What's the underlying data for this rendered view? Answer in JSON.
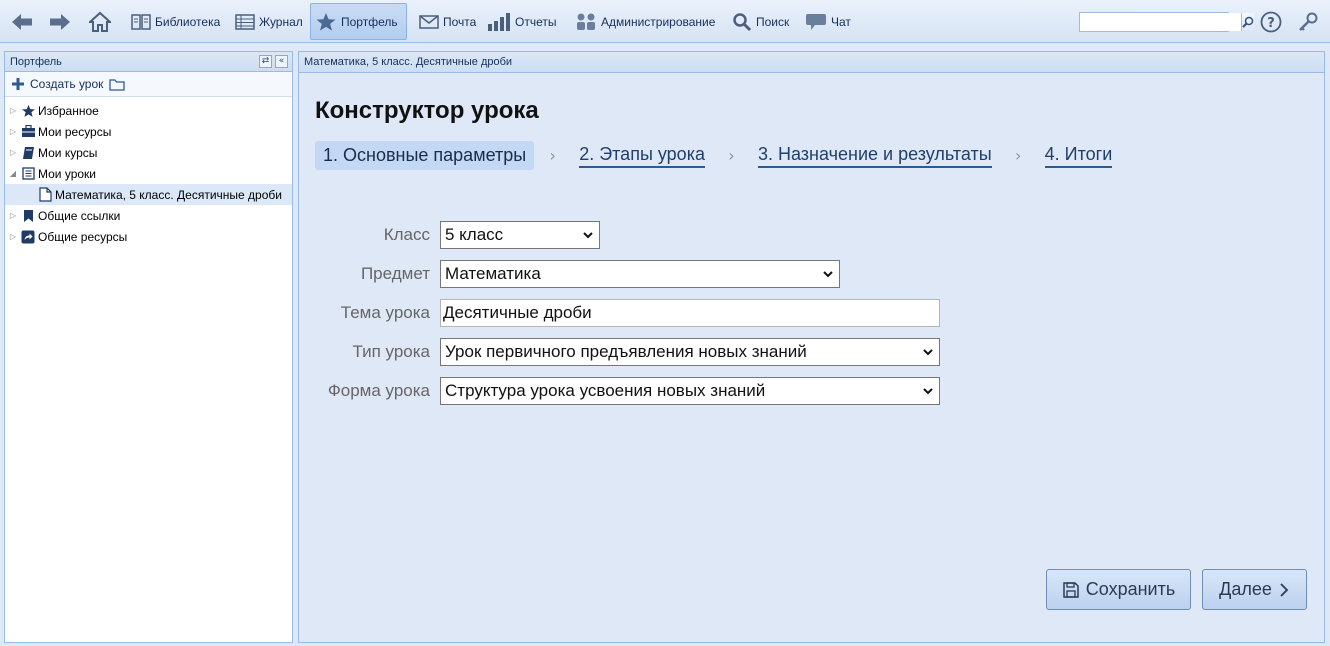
{
  "toolbar": {
    "items": [
      {
        "label": "Библиотека",
        "icon": "book-icon"
      },
      {
        "label": "Журнал",
        "icon": "journal-icon"
      },
      {
        "label": "Портфель",
        "icon": "star-icon"
      },
      {
        "label": "Почта",
        "icon": "mail-icon"
      },
      {
        "label": "Отчеты",
        "icon": "reports-icon"
      },
      {
        "label": "Администрирование",
        "icon": "admin-icon"
      },
      {
        "label": "Поиск",
        "icon": "search-icon"
      },
      {
        "label": "Чат",
        "icon": "chat-icon"
      }
    ],
    "active": "Портфель",
    "search_value": ""
  },
  "left_panel": {
    "title": "Портфель",
    "create_label": "Создать урок",
    "tree": [
      {
        "label": "Избранное",
        "icon": "star-icon",
        "expanded": false
      },
      {
        "label": "Мои ресурсы",
        "icon": "briefcase-icon",
        "expanded": false
      },
      {
        "label": "Мои курсы",
        "icon": "course-book-icon",
        "expanded": false
      },
      {
        "label": "Мои уроки",
        "icon": "lessons-icon",
        "expanded": true
      },
      {
        "label": "Математика, 5 класс. Десятичные дроби",
        "icon": "document-icon",
        "child": true,
        "selected": true
      },
      {
        "label": "Общие ссылки",
        "icon": "bookmark-icon",
        "expanded": false
      },
      {
        "label": "Общие ресурсы",
        "icon": "share-icon",
        "expanded": false
      }
    ]
  },
  "main": {
    "breadcrumb": "Математика, 5 класс. Десятичные дроби",
    "title": "Конструктор урока",
    "steps": [
      "1. Основные параметры",
      "2. Этапы урока",
      "3. Назначение и результаты",
      "4. Итоги"
    ],
    "active_step": 0,
    "form": {
      "class_label": "Класс",
      "class_value": "5 класс",
      "subject_label": "Предмет",
      "subject_value": "Математика",
      "topic_label": "Тема урока",
      "topic_value": "Десятичные дроби",
      "type_label": "Тип урока",
      "type_value": "Урок первичного предъявления новых знаний",
      "form_label": "Форма урока",
      "form_value": "Структура урока усвоения новых знаний"
    },
    "save_label": "Сохранить",
    "next_label": "Далее"
  }
}
